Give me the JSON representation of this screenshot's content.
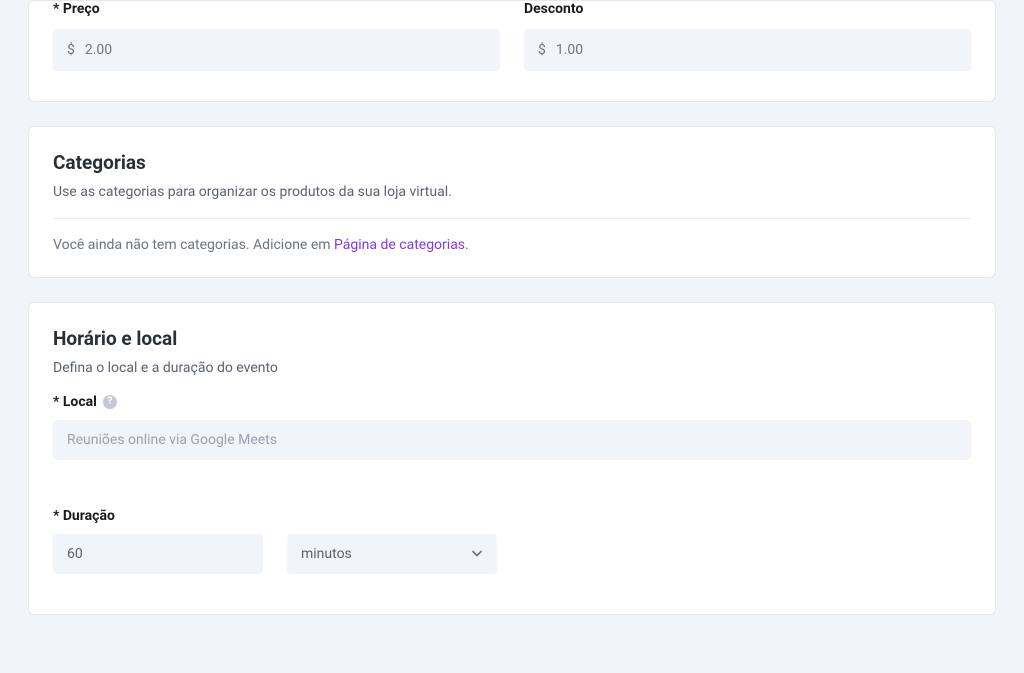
{
  "pricing": {
    "price_label": "* Preço",
    "price_prefix": "$",
    "price_value": "2.00",
    "discount_label": "Desconto",
    "discount_prefix": "$",
    "discount_value": "1.00"
  },
  "categories": {
    "title": "Categorias",
    "subtitle": "Use as categorias para organizar os produtos da sua loja virtual.",
    "empty_prefix": "Você ainda não tem categorias. Adicione em ",
    "link_text": "Página de categorias",
    "empty_suffix": "."
  },
  "schedule": {
    "title": "Horário e local",
    "subtitle": "Defina o local e a duração do evento",
    "local_label": "* Local",
    "local_placeholder": "Reuniões online via Google Meets",
    "duration_label": "* Duração",
    "duration_value": "60",
    "duration_unit": "minutos"
  }
}
